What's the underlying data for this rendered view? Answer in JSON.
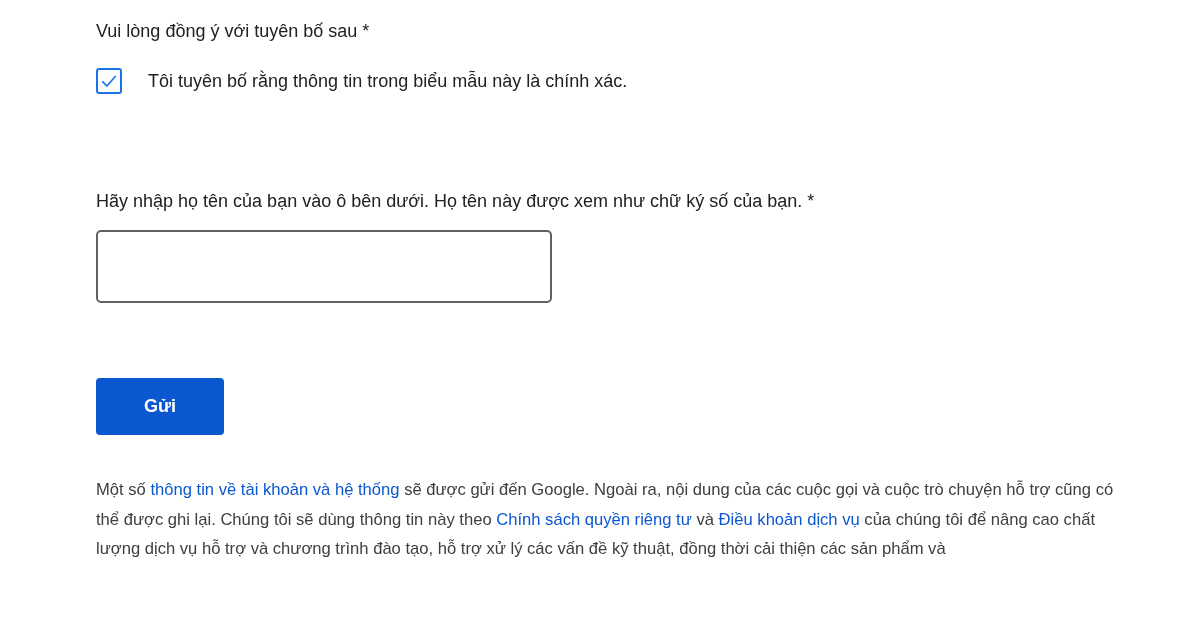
{
  "agreement": {
    "label": "Vui lòng đồng ý với tuyên bố sau *",
    "checkbox": {
      "label": "Tôi tuyên bố rằng thông tin trong biểu mẫu này là chính xác.",
      "checked": true
    }
  },
  "name_field": {
    "label": "Hãy nhập họ tên của bạn vào ô bên dưới. Họ tên này được xem như chữ ký số của bạn. *"
  },
  "submit_button": {
    "label": "Gửi"
  },
  "disclaimer": [
    {
      "kind": "text",
      "text": "Một số "
    },
    {
      "kind": "link",
      "text": "thông tin về tài khoản và hệ thống"
    },
    {
      "kind": "text",
      "text": " sẽ được gửi đến Google. Ngoài ra, nội dung của các cuộc gọi và cuộc trò chuyện hỗ trợ cũng có thể được ghi lại. Chúng tôi sẽ dùng thông tin này theo "
    },
    {
      "kind": "link",
      "text": "Chính sách quyền riêng tư"
    },
    {
      "kind": "text",
      "text": " và "
    },
    {
      "kind": "link",
      "text": "Điều khoản dịch vụ"
    },
    {
      "kind": "text",
      "text": " của chúng tôi để nâng cao chất lượng dịch vụ hỗ trợ và chương trình đào tạo, hỗ trợ xử lý các vấn đề kỹ thuật, đồng thời cải thiện các sản phẩm và"
    }
  ]
}
